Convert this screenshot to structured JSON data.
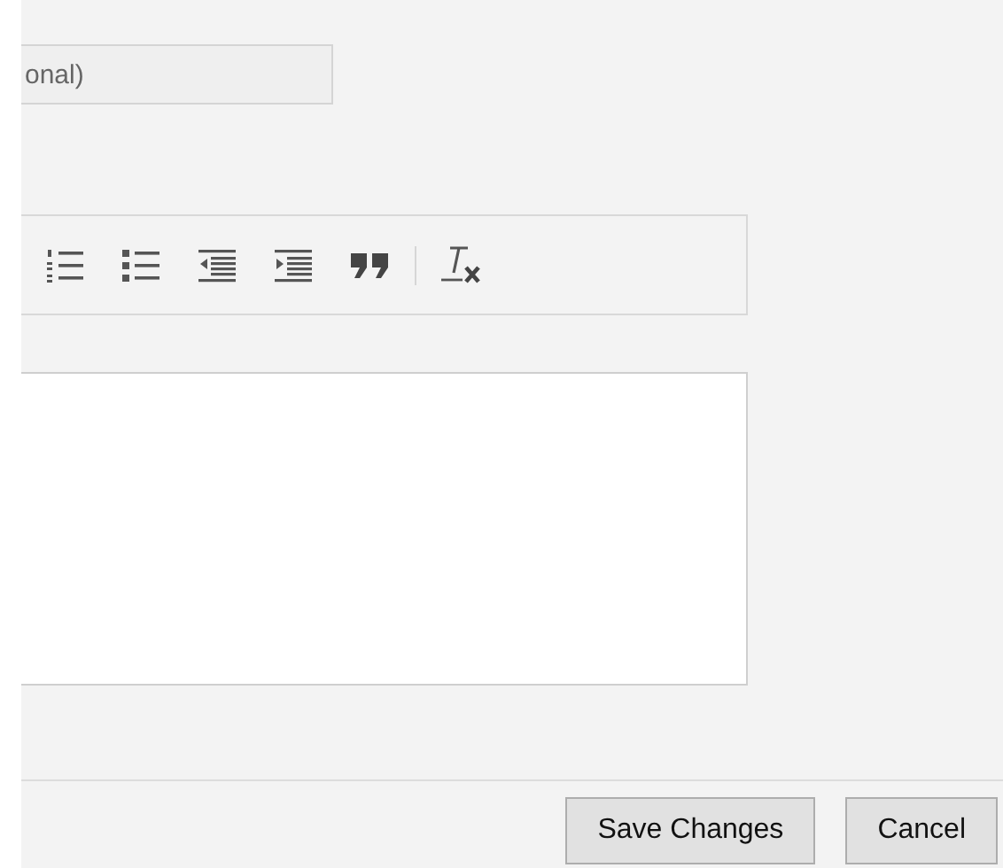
{
  "field": {
    "placeholder": "onal)"
  },
  "toolbar": [
    {
      "kind": "numbered-list"
    },
    {
      "kind": "bullet-list"
    },
    {
      "kind": "outdent"
    },
    {
      "kind": "indent"
    },
    {
      "kind": "blockquote"
    },
    {
      "kind": "separator"
    },
    {
      "kind": "remove-format"
    }
  ],
  "buttons": [
    {
      "label": "Save Changes"
    },
    {
      "label": "Cancel"
    }
  ]
}
